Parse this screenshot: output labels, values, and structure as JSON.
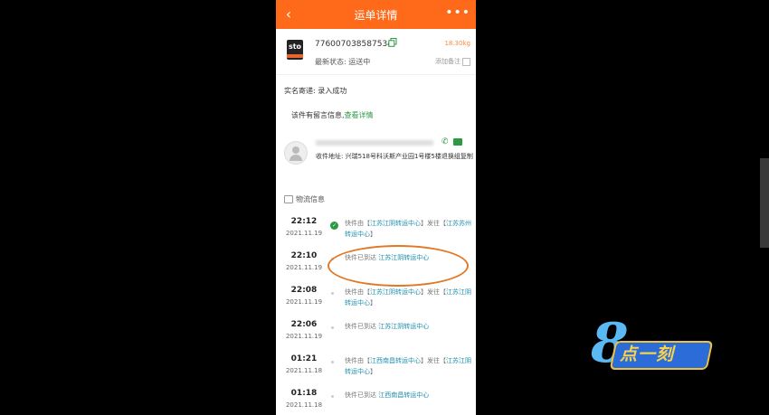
{
  "header": {
    "title": "运单详情",
    "back": "‹",
    "more": "•••"
  },
  "shipment": {
    "logo": "sto",
    "tracking_number": "776007038587534",
    "weight": "18.30kg",
    "status": "最新状态: 运送中",
    "add_note": "添加备注"
  },
  "realname": "实名寄递:  录入成功",
  "message": {
    "text": "该件有留言信息,",
    "link": "查看详情"
  },
  "receiver": {
    "address": "收件地址:  兴瑞518号科沃斯产业园1号楼5楼退换组复制",
    "phone_icon": "✆"
  },
  "logistics_title": "物流信息",
  "events": [
    {
      "time": "22:12",
      "date": "2021.11.19",
      "pre": "快件由【",
      "hl1": "江苏江阴转运中心",
      "mid": "】发往【",
      "hl2": "江苏苏州转运中心",
      "post": "】",
      "done": true
    },
    {
      "time": "22:10",
      "date": "2021.11.19",
      "pre": "快件已到达 ",
      "hl1": "江苏江阴转运中心",
      "mid": "",
      "hl2": "",
      "post": "",
      "done": false
    },
    {
      "time": "22:08",
      "date": "2021.11.19",
      "pre": "快件由【",
      "hl1": "江苏江阴转运中心",
      "mid": "】发往【",
      "hl2": "江苏江阴转运中心",
      "post": "】",
      "done": false
    },
    {
      "time": "22:06",
      "date": "2021.11.19",
      "pre": "快件已到达 ",
      "hl1": "江苏江阴转运中心",
      "mid": "",
      "hl2": "",
      "post": "",
      "done": false
    },
    {
      "time": "01:21",
      "date": "2021.11.18",
      "pre": "快件由【",
      "hl1": "江西南昌转运中心",
      "mid": "】发往【",
      "hl2": "江苏江阴转运中心",
      "post": "】",
      "done": false
    },
    {
      "time": "01:18",
      "date": "2021.11.18",
      "pre": "快件已到达 ",
      "hl1": "江西南昌转运中心",
      "mid": "",
      "hl2": "",
      "post": "",
      "done": false
    }
  ],
  "badge": {
    "digit": "8",
    "text": "点一刻"
  },
  "colors": {
    "accent": "#ff6a1a",
    "green": "#2a9a43",
    "link": "#1d8fb0",
    "annotation": "#e07826"
  }
}
